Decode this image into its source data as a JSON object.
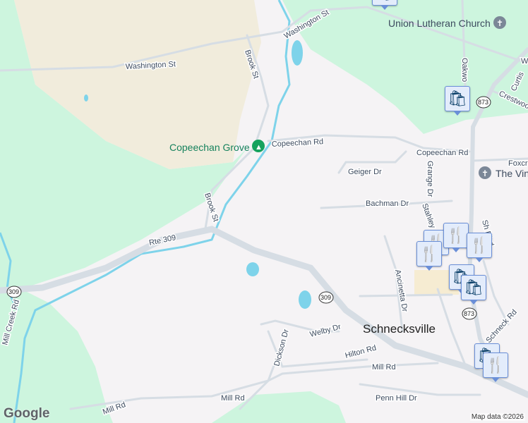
{
  "map": {
    "labels": {
      "washington_st_1": "Washington St",
      "washington_st_2": "Washington St",
      "union_lutheran": "Union Lutheran Church",
      "oakwood": "Oakwo",
      "brook_st_1": "Brook St",
      "brook_st_2": "Brook St",
      "copeechan_grove": "Copeechan Grove",
      "copeechan_rd_1": "Copeechan Rd",
      "copeechan_rd_2": "Copeechan Rd",
      "geiger_dr": "Geiger Dr",
      "grange_dr": "Grange Dr",
      "bachman_dr": "Bachman Dr",
      "stahley": "Stahley",
      "rte_309": "Rte 309",
      "welby_dr": "Welby Dr",
      "dickson_dr": "Dickson Dr",
      "hilton_rd": "Hilton Rd",
      "mill_rd_1": "Mill Rd",
      "mill_rd_2": "Mill Rd",
      "penn_hill_dr": "Penn Hill Dr",
      "mill_creek_rd": "Mill Creek Rd",
      "schnecksville": "Schnecksville",
      "ancinetta_dr": "Ancinetta Dr",
      "crestwood": "Crestwoo",
      "curtis": "Curtis",
      "foxcr": "Foxcr",
      "the_vin": "The Vin",
      "schneck_rd": "Schneck Rd",
      "sh_blvd": "Sh    Blvd",
      "w_edge": "W"
    },
    "shields": {
      "route_309_a": "309",
      "route_309_b": "309",
      "route_873_a": "873",
      "route_873_b": "873"
    },
    "pins": [
      "shopping-bag",
      "restaurant",
      "restaurant",
      "restaurant",
      "restaurant",
      "shopping-bag",
      "shopping-bag",
      "shopping-bag",
      "restaurant"
    ],
    "attribution": "Map data ©2026",
    "logo": "Google"
  },
  "colors": {
    "park": "#cdf5de",
    "land": "#f5f3f5",
    "sand": "#f1ecdc",
    "water": "#7ed3ea",
    "road": "#d6dde4"
  }
}
